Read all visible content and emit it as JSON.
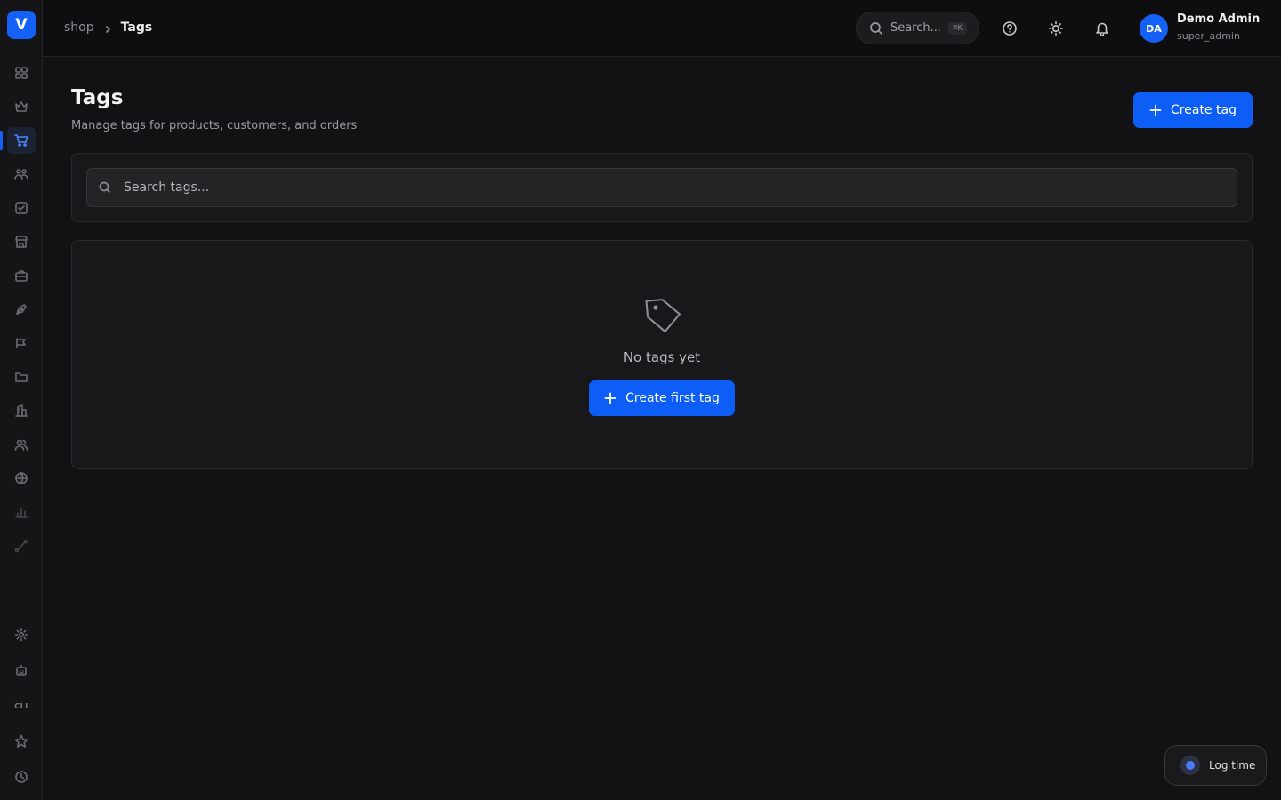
{
  "app": {
    "logo_letter": "V"
  },
  "sidebar": {
    "items": [
      {
        "icon": "dashboard-grid-icon"
      },
      {
        "icon": "crown-icon"
      },
      {
        "icon": "shopping-cart-icon",
        "active": true
      },
      {
        "icon": "users-icon"
      },
      {
        "icon": "checkbox-icon"
      },
      {
        "icon": "store-icon"
      },
      {
        "icon": "briefcase-icon"
      },
      {
        "icon": "pen-tool-icon"
      },
      {
        "icon": "megaphone-icon"
      },
      {
        "icon": "folder-icon"
      },
      {
        "icon": "building-icon"
      },
      {
        "icon": "team-icon"
      },
      {
        "icon": "globe-icon"
      },
      {
        "icon": "bar-chart-icon"
      },
      {
        "icon": "route-icon"
      }
    ],
    "bottom_items": [
      {
        "icon": "settings-icon"
      },
      {
        "icon": "robot-icon"
      },
      {
        "icon": "cli-icon",
        "label": "CLI"
      },
      {
        "icon": "star-icon"
      },
      {
        "icon": "clock-icon"
      }
    ]
  },
  "header": {
    "breadcrumb": {
      "parent": "shop",
      "current": "Tags"
    },
    "search": {
      "label": "Search...",
      "shortcut": "⌘K"
    },
    "user": {
      "initials": "DA",
      "name": "Demo Admin",
      "role": "super_admin"
    }
  },
  "page": {
    "title": "Tags",
    "subtitle": "Manage tags for products, customers, and orders",
    "create_button": "Create tag"
  },
  "filter": {
    "search_placeholder": "Search tags..."
  },
  "empty_state": {
    "message": "No tags yet",
    "button": "Create first tag"
  },
  "log_time": {
    "label": "Log time"
  },
  "colors": {
    "accent": "#0d5ef7",
    "background": "#121214",
    "card": "#18181b"
  }
}
